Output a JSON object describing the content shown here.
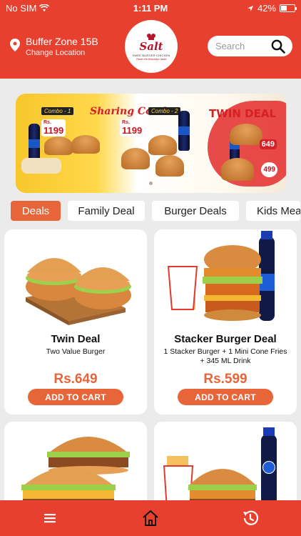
{
  "status_bar": {
    "carrier": "No SIM",
    "time": "1:11 PM",
    "battery": "42%"
  },
  "header": {
    "location_name": "Buffer Zone 15B",
    "change_location": "Change Location",
    "logo_text": "Salt",
    "logo_tagline": "SWEE BURGER CHICKEN",
    "logo_sub": "Taste the Brooklyn taste",
    "search_placeholder": "Search"
  },
  "banner": {
    "title": "Sharing Combo",
    "combo_label_1": "Combo - 1",
    "combo_label_2": "Combo - 2",
    "price_1": "1199",
    "price_2": "1199",
    "currency": "Rs.",
    "twin_deal": "TWIN DEAL",
    "twin_price": "649",
    "twin_price_2": "499",
    "active_slide": 1,
    "slide_count": 1
  },
  "categories": {
    "tabs": [
      {
        "label": "Deals",
        "active": true
      },
      {
        "label": "Family Deal",
        "active": false
      },
      {
        "label": "Burger Deals",
        "active": false
      },
      {
        "label": "Kids Meal",
        "active": false
      }
    ]
  },
  "products": [
    {
      "name": "Twin Deal",
      "description": "Two Value Burger",
      "price": "Rs.649",
      "button": "ADD TO CART"
    },
    {
      "name": "Stacker Burger Deal",
      "description": "1 Stacker Burger + 1 Mini Cone Fries  + 345 ML Drink",
      "price": "Rs.599",
      "button": "ADD TO CART"
    },
    {
      "name": "",
      "description": "",
      "price": "",
      "button": ""
    },
    {
      "name": "",
      "description": "",
      "price": "",
      "button": ""
    }
  ],
  "bottom_nav": {
    "items": [
      {
        "icon": "menu-icon"
      },
      {
        "icon": "home-icon"
      },
      {
        "icon": "history-icon"
      }
    ]
  },
  "colors": {
    "primary_red": "#e8402f",
    "accent_orange": "#e8653a",
    "background": "#ebebeb"
  }
}
